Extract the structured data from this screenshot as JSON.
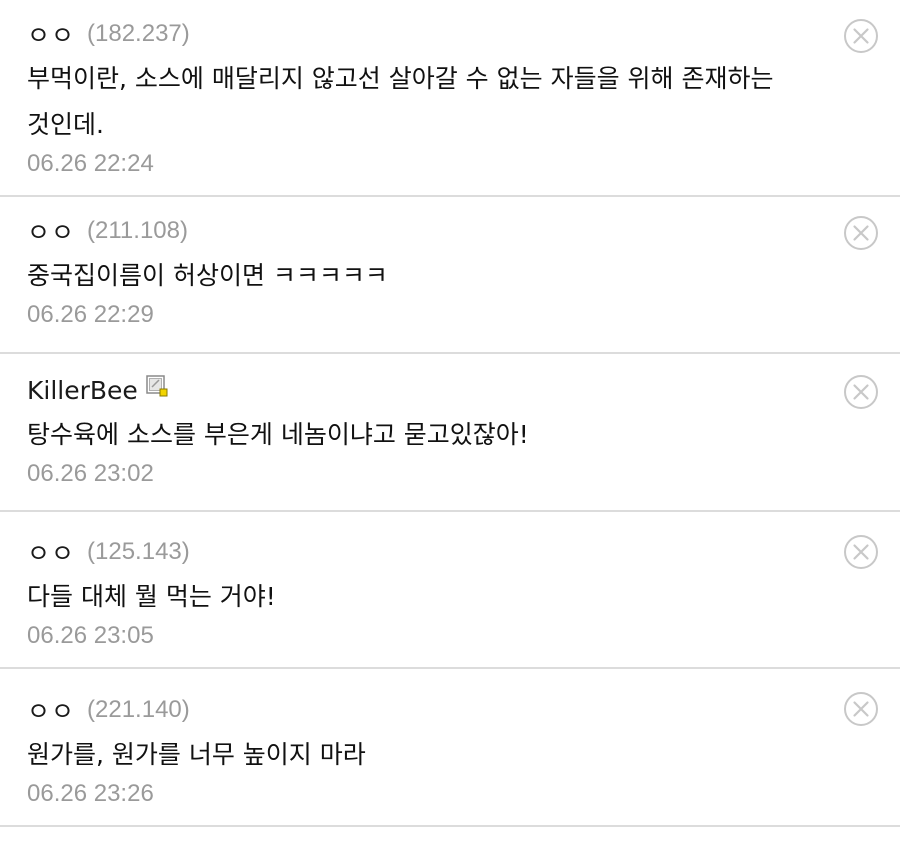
{
  "comments": [
    {
      "author": "ㅇㅇ",
      "ip": "(182.237)",
      "text": "부먹이란, 소스에 매달리지 않고선 살아갈 수 없는 자들을 위해 존재하는 것인데.",
      "date": "06.26 22:24"
    },
    {
      "author": "ㅇㅇ",
      "ip": "(211.108)",
      "text": "중국집이름이 허상이면 ㅋㅋㅋㅋㅋ",
      "date": "06.26 22:29"
    },
    {
      "author": "KillerBee",
      "ip": "",
      "text": "탕수육에 소스를 부은게 네놈이냐고 묻고있잖아!",
      "date": "06.26 23:02"
    },
    {
      "author": "ㅇㅇ",
      "ip": "(125.143)",
      "text": "다들 대체 뭘 먹는 거야!",
      "date": "06.26 23:05"
    },
    {
      "author": "ㅇㅇ",
      "ip": "(221.140)",
      "text": "원가를, 원가를 너무 높이지 마라",
      "date": "06.26 23:26"
    }
  ],
  "icons": {
    "delete": "close-circle-icon",
    "member": "member-badge-icon"
  },
  "colors": {
    "text": "#111111",
    "muted": "#9a9a9a",
    "divider": "#dcdcdc",
    "delete_icon": "#c8c8c8",
    "badge_accent": "#f2d400"
  }
}
